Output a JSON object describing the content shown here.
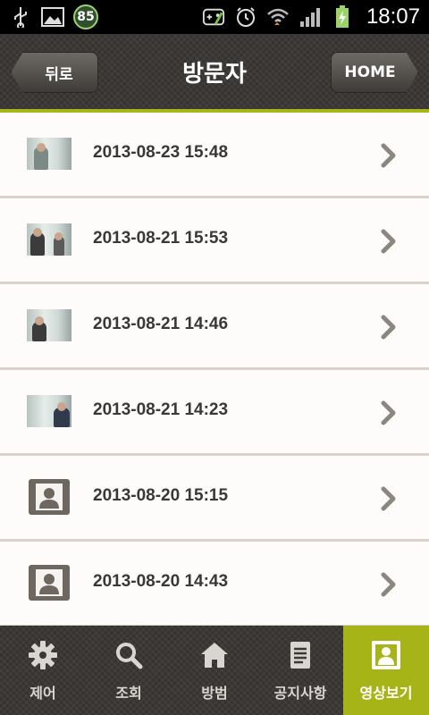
{
  "status_bar": {
    "battery_badge": "85",
    "time": "18:07"
  },
  "header": {
    "title": "방문자",
    "back_label": "뒤로",
    "home_label": "HOME",
    "accent_color": "#a5b51a"
  },
  "visits": [
    {
      "datetime": "2013-08-23 15:48",
      "thumbnail": "photo"
    },
    {
      "datetime": "2013-08-21 15:53",
      "thumbnail": "photo"
    },
    {
      "datetime": "2013-08-21 14:46",
      "thumbnail": "photo"
    },
    {
      "datetime": "2013-08-21 14:23",
      "thumbnail": "photo"
    },
    {
      "datetime": "2013-08-20 15:15",
      "thumbnail": "person-placeholder-icon"
    },
    {
      "datetime": "2013-08-20 14:43",
      "thumbnail": "person-placeholder-icon"
    }
  ],
  "bottom_nav": {
    "items": [
      {
        "label": "제어",
        "icon": "gear-icon",
        "active": false
      },
      {
        "label": "조회",
        "icon": "search-icon",
        "active": false
      },
      {
        "label": "방범",
        "icon": "home-icon",
        "active": false
      },
      {
        "label": "공지사항",
        "icon": "document-icon",
        "active": false
      },
      {
        "label": "영상보기",
        "icon": "video-user-icon",
        "active": true
      }
    ],
    "active_color": "#a6b418"
  }
}
